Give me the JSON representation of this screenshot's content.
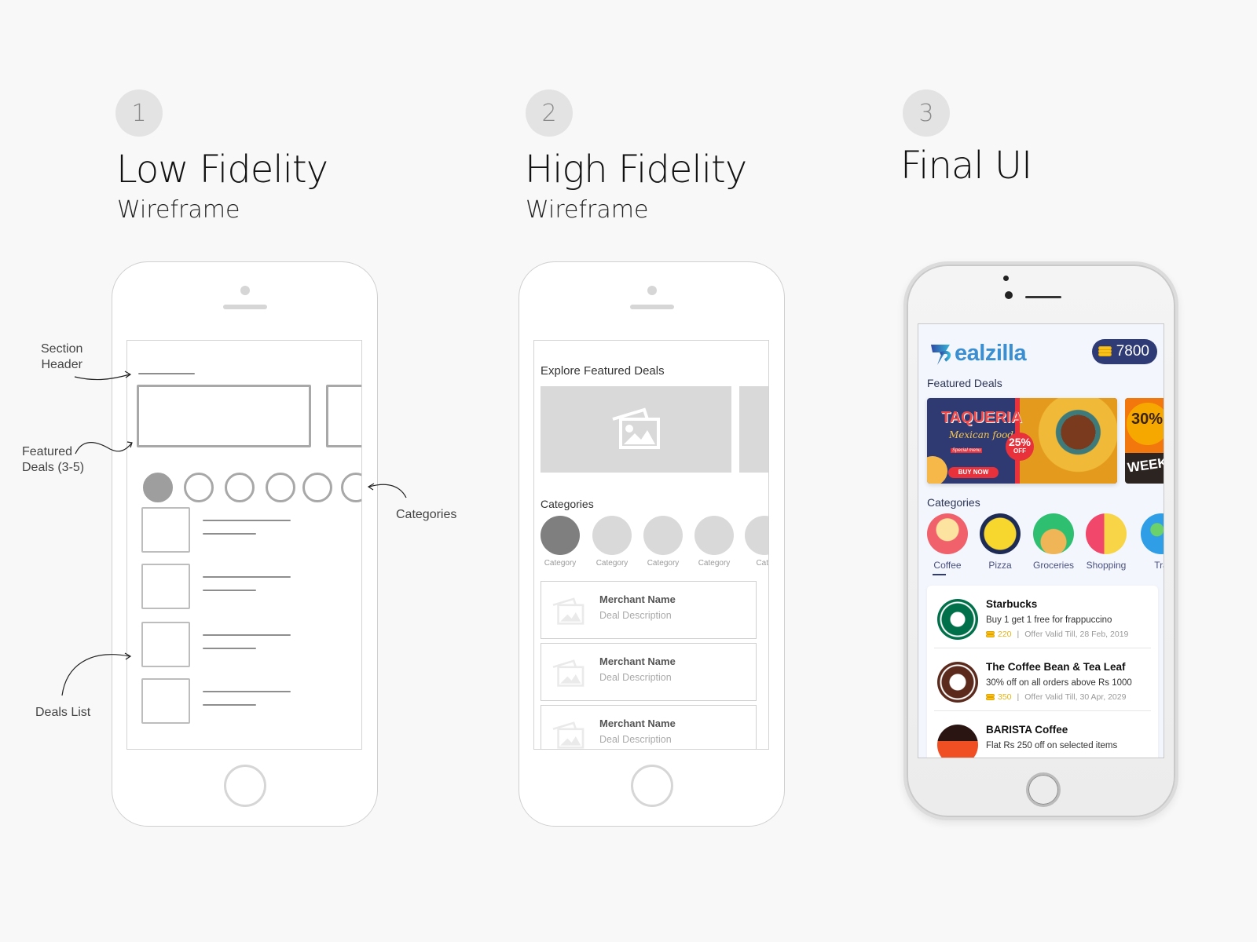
{
  "steps": [
    {
      "number": "1",
      "title": "Low Fidelity",
      "subtitle": "Wireframe"
    },
    {
      "number": "2",
      "title": "High Fidelity",
      "subtitle": "Wireframe"
    },
    {
      "number": "3",
      "title": "Final UI",
      "subtitle": ""
    }
  ],
  "lowfi": {
    "annotations": {
      "section_header": "Section\nHeader",
      "featured_deals": "Featured\nDeals (3-5)",
      "categories": "Categories",
      "deals_list": "Deals List"
    }
  },
  "hifi": {
    "section_title": "Explore Featured Deals",
    "categories_title": "Categories",
    "categories": [
      "Category",
      "Category",
      "Category",
      "Category",
      "Cate"
    ],
    "deals": [
      {
        "merchant": "Merchant Name",
        "description": "Deal Description"
      },
      {
        "merchant": "Merchant Name",
        "description": "Deal Description"
      },
      {
        "merchant": "Merchant Name",
        "description": "Deal Description"
      }
    ]
  },
  "final": {
    "brand": "ealzilla",
    "coins": "7800",
    "featured_title": "Featured Deals",
    "banner": {
      "headline": "TAQUERIA",
      "tagline": "Mexican food",
      "special": "Special menu",
      "discount": "25%",
      "discount_suffix": "OFF",
      "cta": "BUY NOW",
      "next_banner_text": "30%",
      "next_banner_sub": "WEEK"
    },
    "categories_title": "Categories",
    "categories": [
      {
        "label": "Coffee",
        "icon": "coffee-cup-icon",
        "active": true
      },
      {
        "label": "Pizza",
        "icon": "pizza-icon",
        "active": false
      },
      {
        "label": "Groceries",
        "icon": "groceries-bag-icon",
        "active": false
      },
      {
        "label": "Shopping",
        "icon": "shopping-bags-icon",
        "active": false
      },
      {
        "label": "Tra",
        "icon": "palm-tree-icon",
        "active": false
      }
    ],
    "deals": [
      {
        "merchant": "Starbucks",
        "description": "Buy 1 get 1 free for frappuccino",
        "points": "220",
        "validity": "Offer Valid Till, 28 Feb, 2019"
      },
      {
        "merchant": "The Coffee Bean & Tea Leaf",
        "description": "30% off on all orders above Rs 1000",
        "points": "350",
        "validity": "Offer Valid Till, 30 Apr, 2029"
      },
      {
        "merchant": "BARISTA Coffee",
        "description": "Flat Rs 250 off on selected items",
        "points": "",
        "validity": ""
      }
    ],
    "meta_separator": "|",
    "colors": {
      "brand_blue": "#3b8fd0",
      "navy": "#2e3b75",
      "coin": "#f7c21c",
      "bg": "#f3f7fd"
    }
  }
}
